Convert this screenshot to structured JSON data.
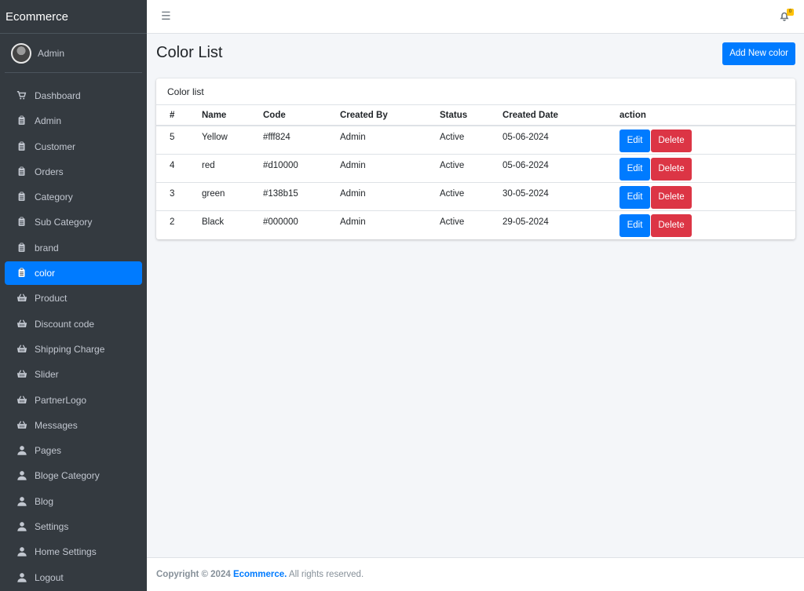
{
  "app": {
    "brand": "Ecommerce"
  },
  "user": {
    "name": "Admin"
  },
  "sidebar": {
    "items": [
      {
        "label": "Dashboard",
        "icon": "cart-icon"
      },
      {
        "label": "Admin",
        "icon": "clipboard-icon"
      },
      {
        "label": "Customer",
        "icon": "clipboard-icon"
      },
      {
        "label": "Orders",
        "icon": "clipboard-icon"
      },
      {
        "label": "Category",
        "icon": "clipboard-icon"
      },
      {
        "label": "Sub Category",
        "icon": "clipboard-icon"
      },
      {
        "label": "brand",
        "icon": "clipboard-icon"
      },
      {
        "label": "color",
        "icon": "clipboard-icon",
        "active": true
      },
      {
        "label": "Product",
        "icon": "basket-icon"
      },
      {
        "label": "Discount code",
        "icon": "basket-icon"
      },
      {
        "label": "Shipping Charge",
        "icon": "basket-icon"
      },
      {
        "label": "Slider",
        "icon": "basket-icon"
      },
      {
        "label": "PartnerLogo",
        "icon": "basket-icon"
      },
      {
        "label": "Messages",
        "icon": "basket-icon"
      },
      {
        "label": "Pages",
        "icon": "user-icon"
      },
      {
        "label": "Bloge Category",
        "icon": "user-icon"
      },
      {
        "label": "Blog",
        "icon": "user-icon"
      },
      {
        "label": "Settings",
        "icon": "user-icon"
      },
      {
        "label": "Home Settings",
        "icon": "user-icon"
      },
      {
        "label": "Logout",
        "icon": "user-icon"
      }
    ]
  },
  "topbar": {
    "notification_count": "0"
  },
  "main": {
    "title": "Color List",
    "add_button": "Add New color",
    "card_title": "Color list",
    "columns": [
      "#",
      "Name",
      "Code",
      "Created By",
      "Status",
      "Created Date",
      "action"
    ],
    "rows": [
      {
        "id": "5",
        "name": "Yellow",
        "code": "#fff824",
        "created_by": "Admin",
        "status": "Active",
        "created_date": "05-06-2024"
      },
      {
        "id": "4",
        "name": "red",
        "code": "#d10000",
        "created_by": "Admin",
        "status": "Active",
        "created_date": "05-06-2024"
      },
      {
        "id": "3",
        "name": "green",
        "code": "#138b15",
        "created_by": "Admin",
        "status": "Active",
        "created_date": "30-05-2024"
      },
      {
        "id": "2",
        "name": "Black",
        "code": "#000000",
        "created_by": "Admin",
        "status": "Active",
        "created_date": "29-05-2024"
      }
    ],
    "edit_label": "Edit",
    "delete_label": "Delete"
  },
  "footer": {
    "copyright": "Copyright © 2024",
    "brand_link": "Ecommerce.",
    "rights": "All rights reserved."
  },
  "colors": {
    "sidebar_bg": "#343a40",
    "accent": "#007bff",
    "danger": "#dc3545",
    "warning": "#ffc107"
  }
}
